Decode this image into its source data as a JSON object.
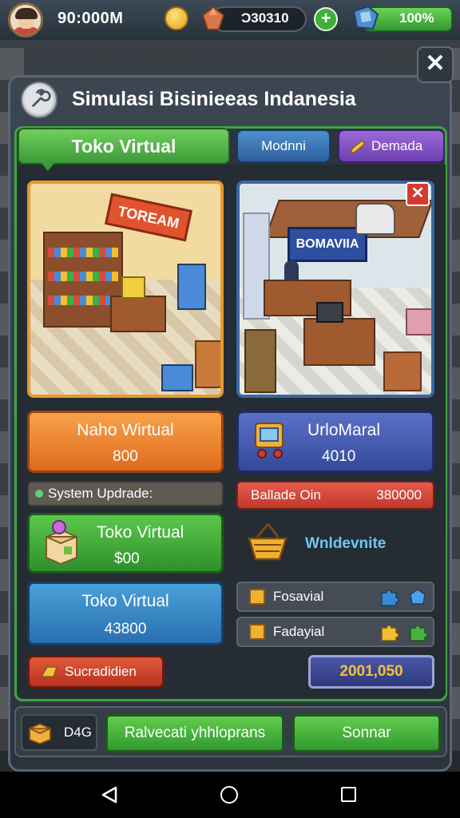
{
  "topbar": {
    "money": "90:000M",
    "gems": "Ͻ30310",
    "energy": "100%",
    "plus_label": "+"
  },
  "panel": {
    "title": "Simulasi Bisinieeas Indanesia",
    "close_label": "✕"
  },
  "tabs": {
    "active": "Toko Virtual",
    "second": "Modnni",
    "third": "Demada"
  },
  "scenes": {
    "left_sign": "TOREAM",
    "right_sign": "BOMAVIIA",
    "close_label": "✕"
  },
  "cards": {
    "orange": {
      "title": "Naho Wirtual",
      "value": "800"
    },
    "blue_right": {
      "title": "UrloMaral",
      "value": "4010"
    },
    "green": {
      "title": "Toko Virtual",
      "value": "$00"
    },
    "teal": {
      "title": "Toko Virtual",
      "value": "43800"
    }
  },
  "system_update": "System Updrade:",
  "balance": {
    "label": "Ballade Oin",
    "value": "380000"
  },
  "wishlist_label": "Wnldevnite",
  "list_rows": [
    {
      "label": "Fosavial"
    },
    {
      "label": "Fadayial"
    }
  ],
  "red_button": "Sucradidien",
  "score": "2001,050",
  "bottom": {
    "dag": "D4G",
    "btn1": "Ralvecati yhhloprans",
    "btn2": "Sonnar"
  },
  "colors": {
    "accent_green": "#3fa440",
    "orange": "#e06a1c",
    "blue": "#334a9a",
    "red": "#c0392b",
    "gold": "#f4c040"
  }
}
